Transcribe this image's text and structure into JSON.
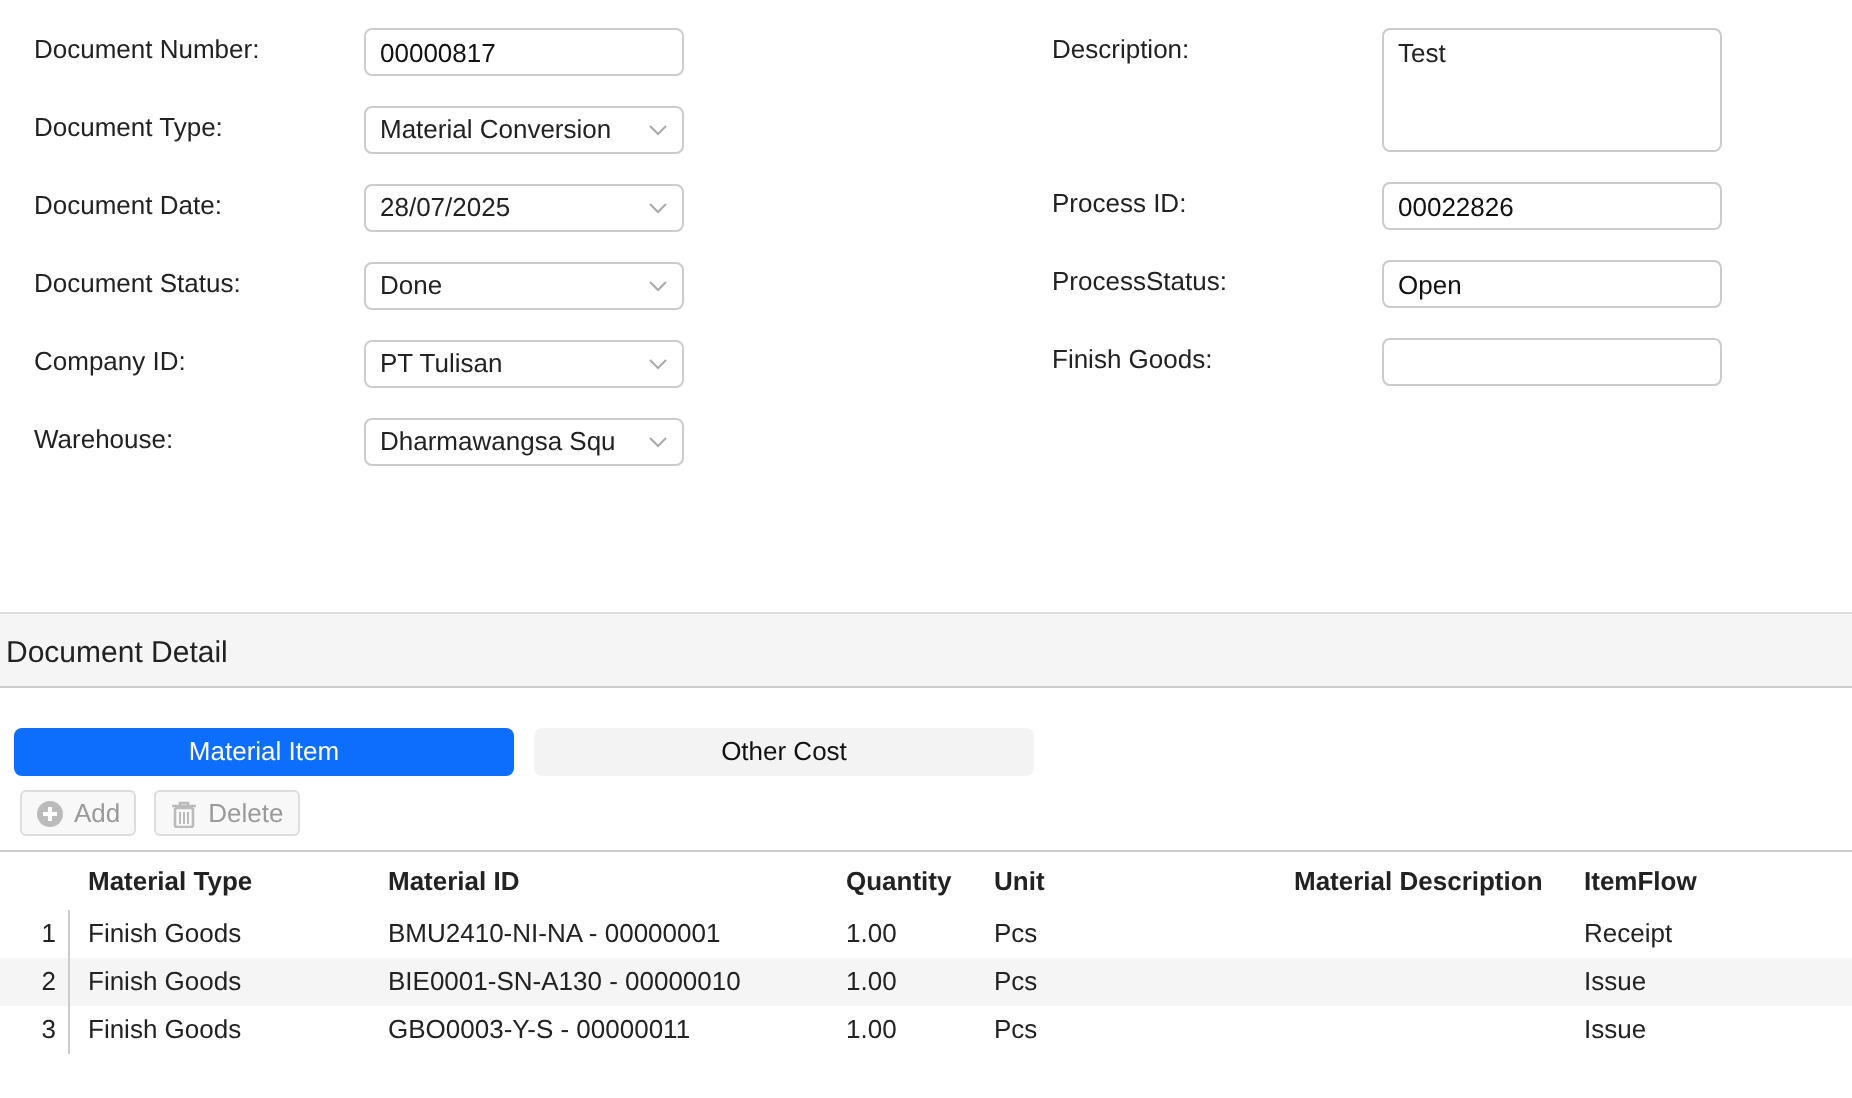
{
  "header_fields": {
    "left": [
      {
        "label": "Document Number:",
        "kind": "input",
        "value": "00000817"
      },
      {
        "label": "Document Type:",
        "kind": "select",
        "value": "Material Conversion"
      },
      {
        "label": "Document Date:",
        "kind": "select",
        "value": "28/07/2025"
      },
      {
        "label": "Document Status:",
        "kind": "select",
        "value": "Done"
      },
      {
        "label": "Company ID:",
        "kind": "select",
        "value": "PT Tulisan"
      },
      {
        "label": "Warehouse:",
        "kind": "select",
        "value": "Dharmawangsa Squ"
      }
    ],
    "right": [
      {
        "label": "Description:",
        "kind": "textarea",
        "value": "Test"
      },
      {
        "label": "Process ID:",
        "kind": "input",
        "value": "00022826"
      },
      {
        "label": "ProcessStatus:",
        "kind": "input",
        "value": "Open"
      },
      {
        "label": "Finish Goods:",
        "kind": "input"
      }
    ]
  },
  "section": {
    "title": "Document Detail"
  },
  "tabs": [
    {
      "label": "Material Item",
      "selected": true
    },
    {
      "label": "Other Cost",
      "selected": false
    }
  ],
  "toolbar": [
    {
      "label": "Add",
      "kind": "add",
      "disabled": true
    },
    {
      "label": "Delete",
      "kind": "delete",
      "disabled": true
    }
  ],
  "table": {
    "columns": [
      "Material Type",
      "Material ID",
      "Quantity",
      "Unit",
      "Material Description",
      "ItemFlow"
    ],
    "rows": [
      {
        "number": "1",
        "cells": [
          "Finish Goods",
          "BMU2410-NI-NA - 00000001",
          "1.00",
          "Pcs",
          null,
          "Receipt"
        ]
      },
      {
        "number": "2",
        "cells": [
          "Finish Goods",
          "BIE0001-SN-A130 - 00000010",
          "1.00",
          "Pcs",
          null,
          "Issue"
        ]
      },
      {
        "number": "3",
        "cells": [
          "Finish Goods",
          "GBO0003-Y-S - 00000011",
          "1.00",
          "Pcs",
          null,
          "Issue"
        ]
      }
    ]
  }
}
